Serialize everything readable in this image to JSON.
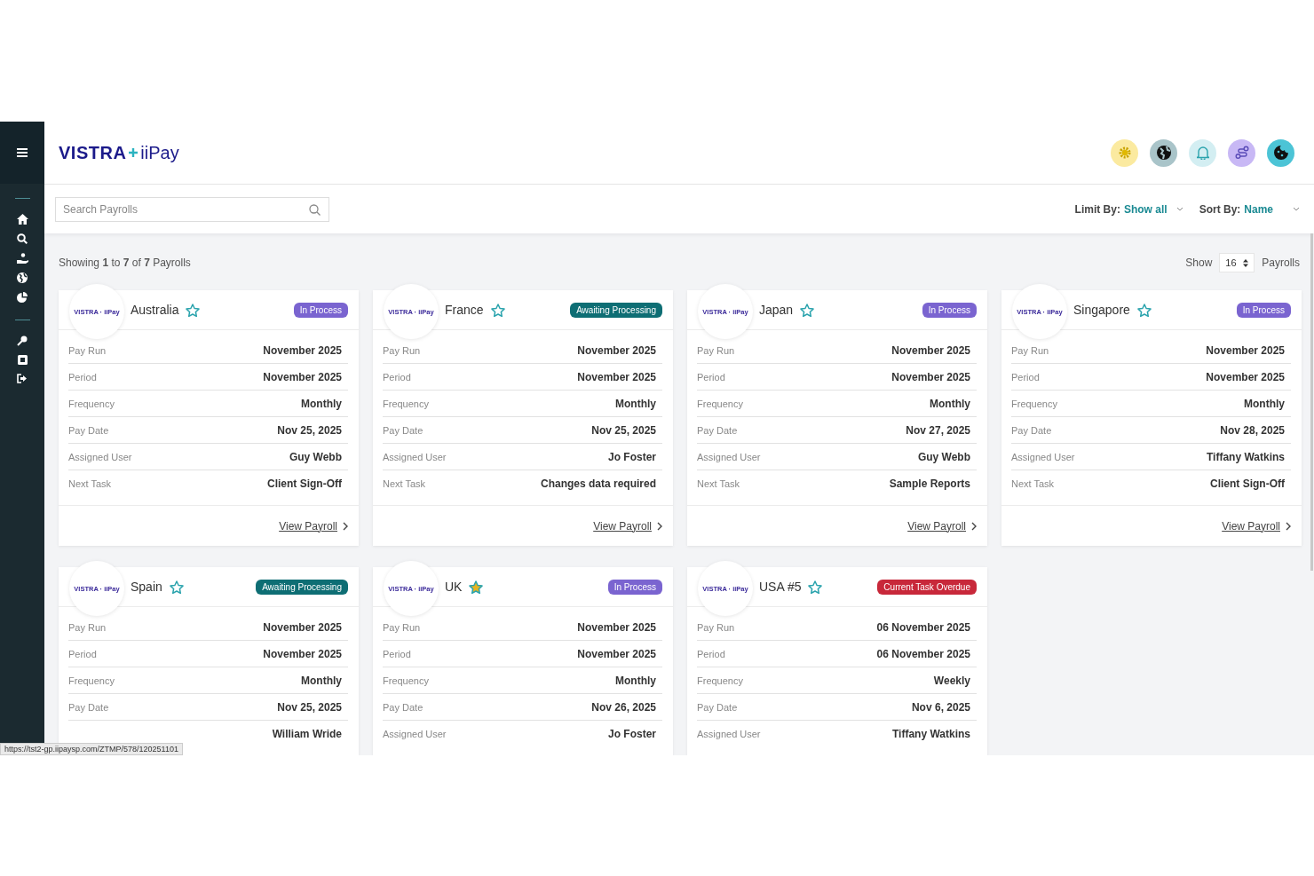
{
  "brand": {
    "name": "VISTRA",
    "product": "iiPay"
  },
  "search": {
    "placeholder": "Search Payrolls"
  },
  "limit_by": {
    "label": "Limit By:",
    "value": "Show all"
  },
  "sort_by": {
    "label": "Sort By:",
    "value": "Name"
  },
  "summary": {
    "text": "Showing **1** to **7** of **7** Payrolls"
  },
  "page_size": {
    "label": "Show",
    "value": "16",
    "unit": "Payrolls"
  },
  "cards": [
    {
      "country": "Australia",
      "favorite": false,
      "logo": "VISTRA · iiPay",
      "status": {
        "text": "In Process",
        "kind": "in_process"
      },
      "rows": [
        {
          "label": "Pay Run",
          "value": "November 2025"
        },
        {
          "label": "Period",
          "value": "November 2025"
        },
        {
          "label": "Frequency",
          "value": "Monthly"
        },
        {
          "label": "Pay Date",
          "value": "Nov 25, 2025"
        },
        {
          "label": "Assigned User",
          "value": "Guy Webb"
        },
        {
          "label": "Next Task",
          "value": "Client Sign-Off"
        }
      ],
      "link": "View Payroll"
    },
    {
      "country": "France",
      "favorite": false,
      "logo": "VISTRA · iiPay",
      "status": {
        "text": "Awaiting Processing",
        "kind": "awaiting"
      },
      "rows": [
        {
          "label": "Pay Run",
          "value": "November 2025"
        },
        {
          "label": "Period",
          "value": "November 2025"
        },
        {
          "label": "Frequency",
          "value": "Monthly"
        },
        {
          "label": "Pay Date",
          "value": "Nov 25, 2025"
        },
        {
          "label": "Assigned User",
          "value": "Jo Foster"
        },
        {
          "label": "Next Task",
          "value": "Changes data required"
        }
      ],
      "link": "View Payroll"
    },
    {
      "country": "Japan",
      "favorite": false,
      "logo": "VISTRA · iiPay",
      "status": {
        "text": "In Process",
        "kind": "in_process"
      },
      "rows": [
        {
          "label": "Pay Run",
          "value": "November 2025"
        },
        {
          "label": "Period",
          "value": "November 2025"
        },
        {
          "label": "Frequency",
          "value": "Monthly"
        },
        {
          "label": "Pay Date",
          "value": "Nov 27, 2025"
        },
        {
          "label": "Assigned User",
          "value": "Guy Webb"
        },
        {
          "label": "Next Task",
          "value": "Sample Reports"
        }
      ],
      "link": "View Payroll"
    },
    {
      "country": "Singapore",
      "favorite": false,
      "logo": "VISTRA · iiPay",
      "status": {
        "text": "In Process",
        "kind": "in_process"
      },
      "rows": [
        {
          "label": "Pay Run",
          "value": "November 2025"
        },
        {
          "label": "Period",
          "value": "November 2025"
        },
        {
          "label": "Frequency",
          "value": "Monthly"
        },
        {
          "label": "Pay Date",
          "value": "Nov 28, 2025"
        },
        {
          "label": "Assigned User",
          "value": "Tiffany Watkins"
        },
        {
          "label": "Next Task",
          "value": "Client Sign-Off"
        }
      ],
      "link": "View Payroll"
    },
    {
      "country": "Spain",
      "favorite": false,
      "logo": "VISTRA · iiPay",
      "status": {
        "text": "Awaiting Processing",
        "kind": "awaiting"
      },
      "rows": [
        {
          "label": "Pay Run",
          "value": "November 2025"
        },
        {
          "label": "Period",
          "value": "November 2025"
        },
        {
          "label": "Frequency",
          "value": "Monthly"
        },
        {
          "label": "Pay Date",
          "value": "Nov 25, 2025"
        },
        {
          "value": "William Wride"
        }
      ]
    },
    {
      "country": "UK",
      "favorite": true,
      "logo": "VISTRA · iiPay",
      "status": {
        "text": "In Process",
        "kind": "in_process"
      },
      "rows": [
        {
          "label": "Pay Run",
          "value": "November 2025"
        },
        {
          "label": "Period",
          "value": "November 2025"
        },
        {
          "label": "Frequency",
          "value": "Monthly"
        },
        {
          "label": "Pay Date",
          "value": "Nov 26, 2025"
        },
        {
          "label": "Assigned User",
          "value": "Jo Foster"
        }
      ]
    },
    {
      "country": "USA #5",
      "favorite": false,
      "logo": "VISTRA · iiPay",
      "status": {
        "text": "Current Task Overdue",
        "kind": "overdue"
      },
      "rows": [
        {
          "label": "Pay Run",
          "value": "06 November 2025"
        },
        {
          "label": "Period",
          "value": "06 November 2025"
        },
        {
          "label": "Frequency",
          "value": "Weekly"
        },
        {
          "label": "Pay Date",
          "value": "Nov 6, 2025"
        },
        {
          "label": "Assigned User",
          "value": "Tiffany Watkins"
        }
      ]
    }
  ],
  "status_url": "https://tst2-gp.iipaysp.com/ZTMP/578/120251101"
}
